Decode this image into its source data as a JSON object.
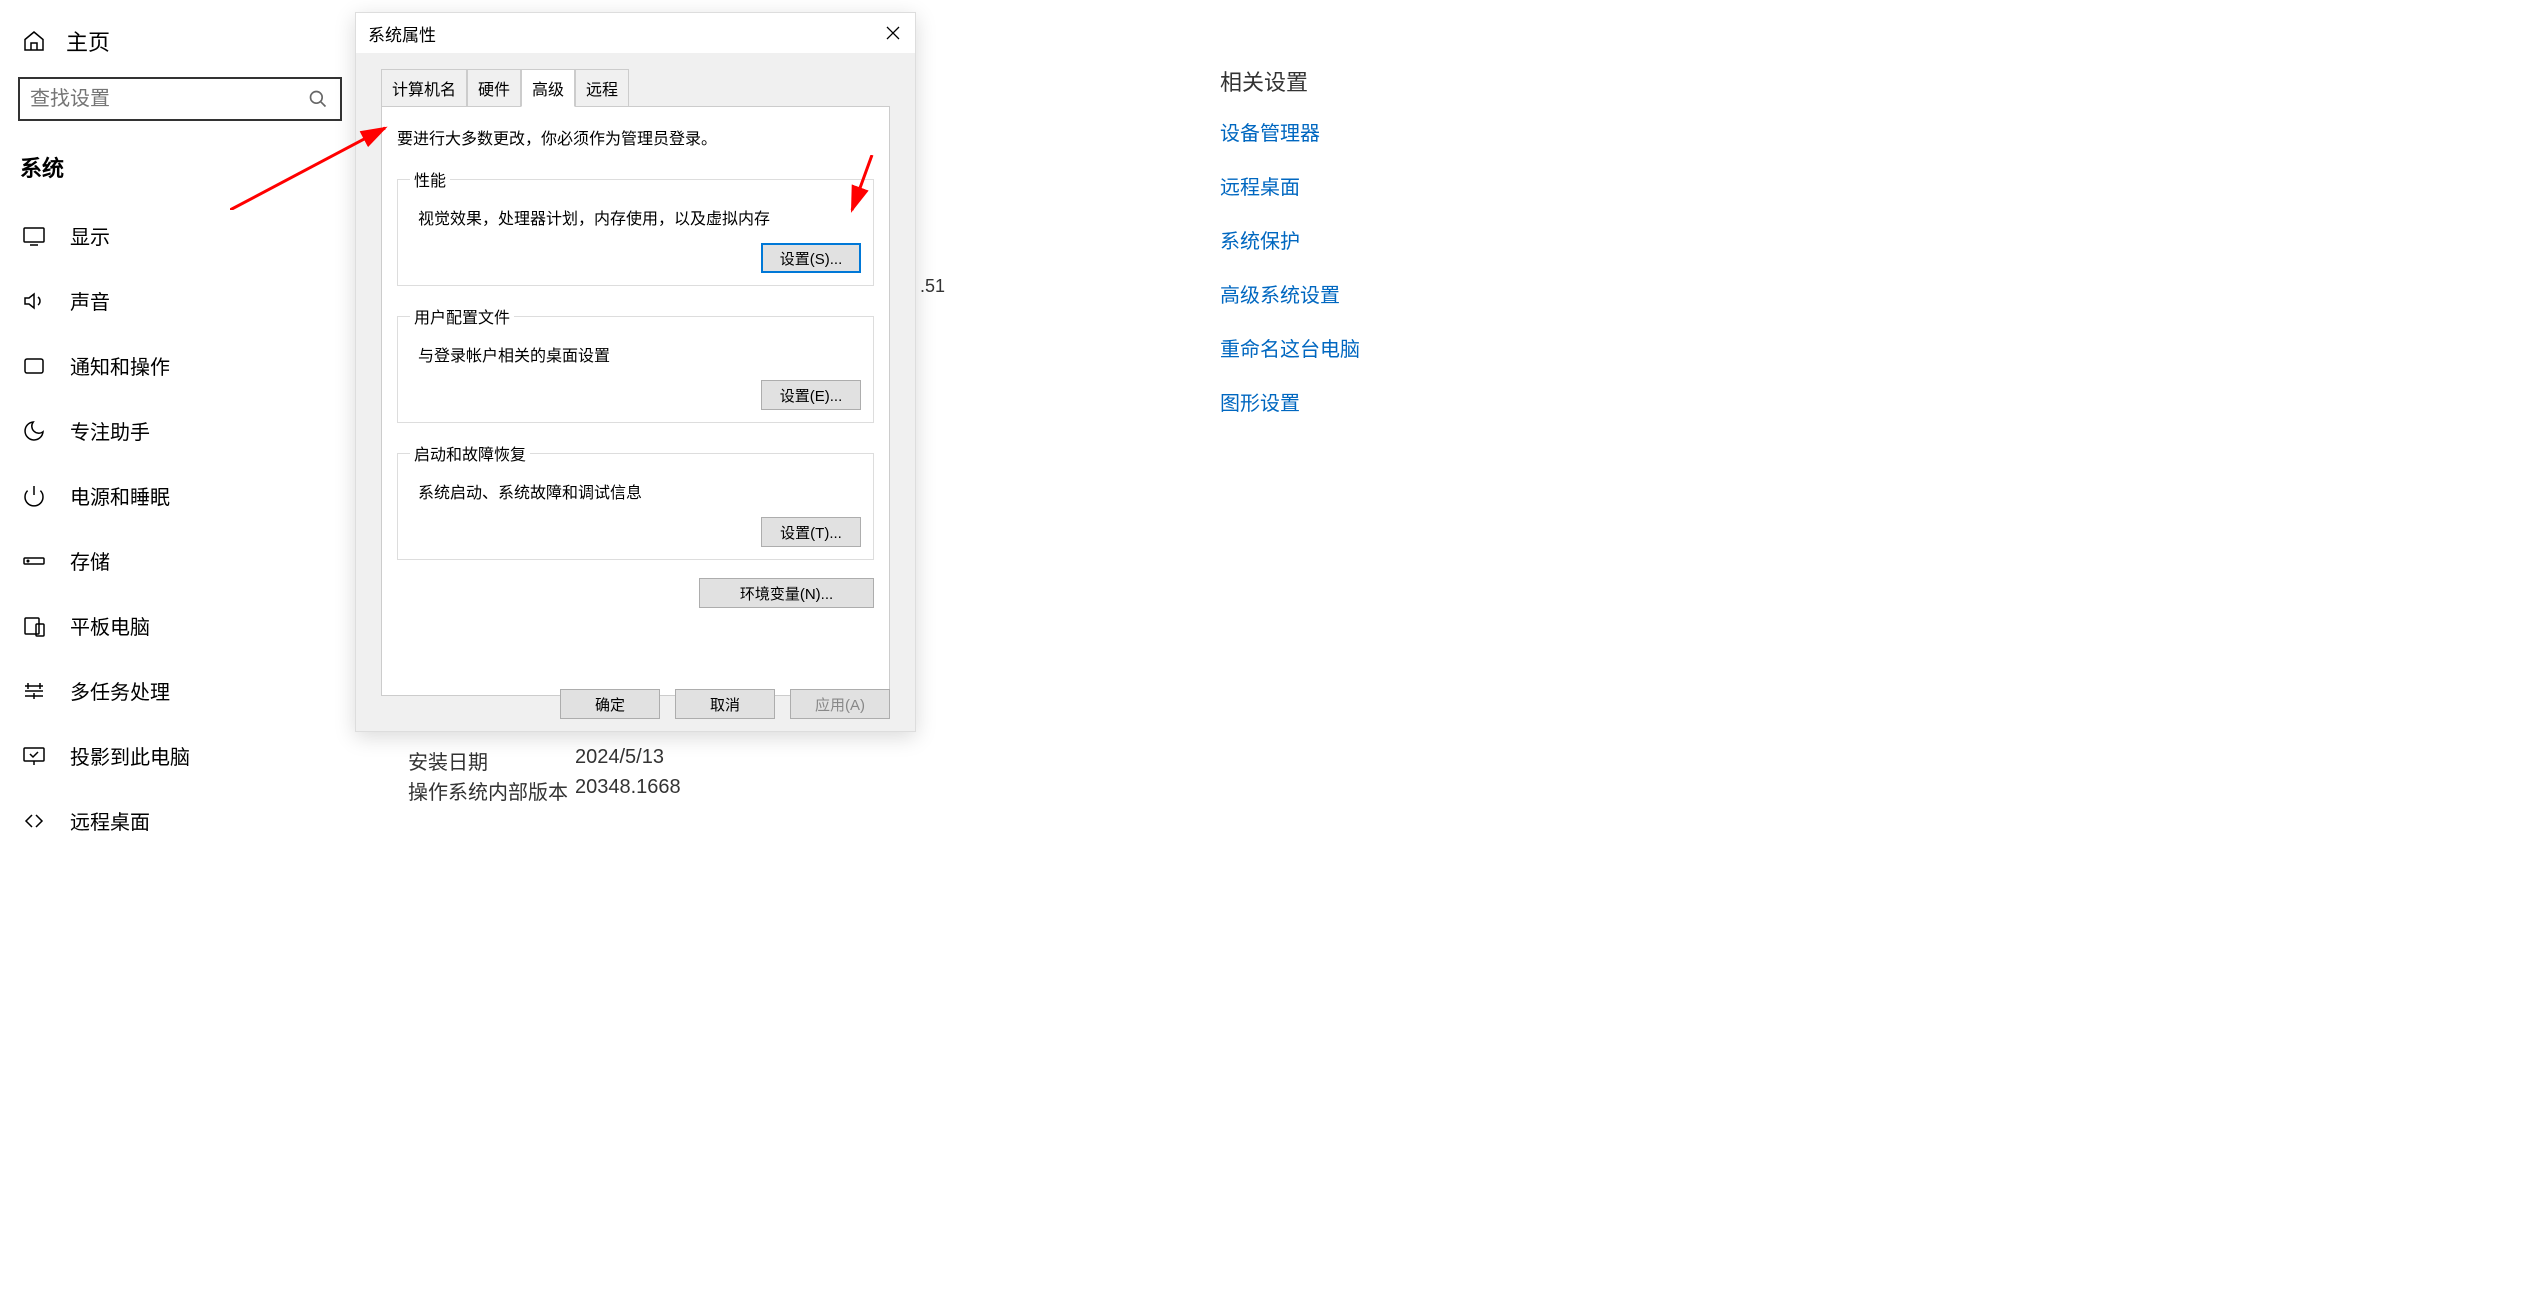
{
  "sidebar": {
    "home": "主页",
    "search_placeholder": "查找设置",
    "section": "系统",
    "items": [
      {
        "label": "显示"
      },
      {
        "label": "声音"
      },
      {
        "label": "通知和操作"
      },
      {
        "label": "专注助手"
      },
      {
        "label": "电源和睡眠"
      },
      {
        "label": "存储"
      },
      {
        "label": "平板电脑"
      },
      {
        "label": "多任务处理"
      },
      {
        "label": "投影到此电脑"
      },
      {
        "label": "远程桌面"
      }
    ]
  },
  "dialog": {
    "title": "系统属性",
    "tabs": [
      "计算机名",
      "硬件",
      "高级",
      "远程"
    ],
    "active_tab": "高级",
    "intro": "要进行大多数更改，你必须作为管理员登录。",
    "group_perf": {
      "legend": "性能",
      "desc": "视觉效果，处理器计划，内存使用，以及虚拟内存",
      "btn": "设置(S)..."
    },
    "group_user": {
      "legend": "用户配置文件",
      "desc": "与登录帐户相关的桌面设置",
      "btn": "设置(E)..."
    },
    "group_boot": {
      "legend": "启动和故障恢复",
      "desc": "系统启动、系统故障和调试信息",
      "btn": "设置(T)..."
    },
    "env_btn": "环境变量(N)...",
    "footer": {
      "ok": "确定",
      "cancel": "取消",
      "apply": "应用(A)"
    }
  },
  "bg": {
    "snippet": ".51",
    "row1_label": "安装日期",
    "row1_value": "2024/5/13",
    "row2_label": "操作系统内部版本",
    "row2_value": "20348.1668"
  },
  "related": {
    "title": "相关设置",
    "links": [
      "设备管理器",
      "远程桌面",
      "系统保护",
      "高级系统设置",
      "重命名这台电脑",
      "图形设置"
    ]
  }
}
